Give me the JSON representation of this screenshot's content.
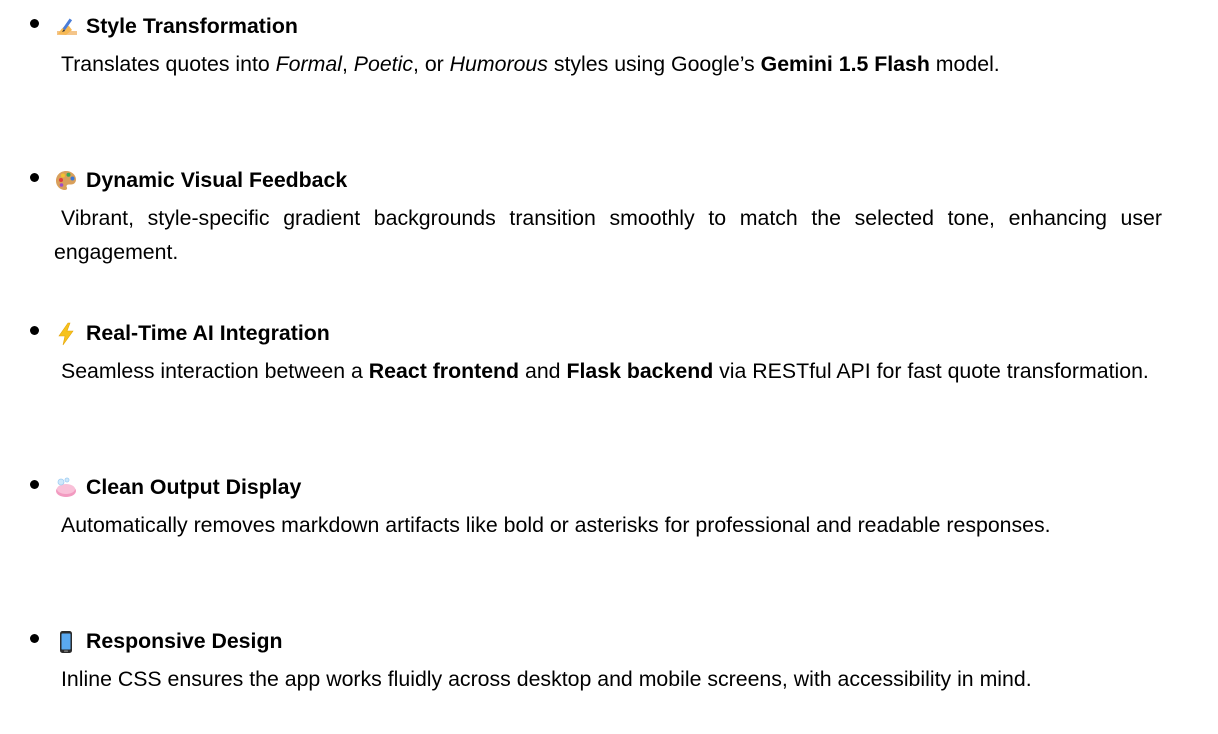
{
  "features": [
    {
      "icon": "writing-hand-icon",
      "title": "Style Transformation",
      "desc": {
        "p1": "Translates quotes into ",
        "formal": "Formal",
        "p2": ", ",
        "poetic": "Poetic",
        "p3": ", or ",
        "humorous": "Humorous",
        "p4": " styles using Google’s ",
        "model": "Gemini 1.5 Flash",
        "p5": " model."
      }
    },
    {
      "icon": "artist-palette-icon",
      "title": "Dynamic Visual Feedback",
      "desc": {
        "text": "Vibrant, style-specific gradient backgrounds transition smoothly to match the selected tone, enhancing user engagement."
      }
    },
    {
      "icon": "lightning-bolt-icon",
      "title": "Real-Time AI Integration",
      "desc": {
        "p1": "Seamless interaction between a ",
        "frontend": "React frontend",
        "p2": " and ",
        "backend": "Flask backend",
        "p3": " via RESTful API for fast quote transformation."
      }
    },
    {
      "icon": "soap-icon",
      "title": "Clean Output Display",
      "desc": {
        "text": "Automatically removes markdown artifacts like bold or asterisks for professional and readable responses."
      }
    },
    {
      "icon": "mobile-phone-icon",
      "title": "Responsive Design",
      "desc": {
        "text": "Inline CSS ensures the app works fluidly across desktop and mobile screens, with accessibility in mind."
      }
    }
  ],
  "colors": {
    "text": "#000000",
    "background": "#ffffff"
  }
}
